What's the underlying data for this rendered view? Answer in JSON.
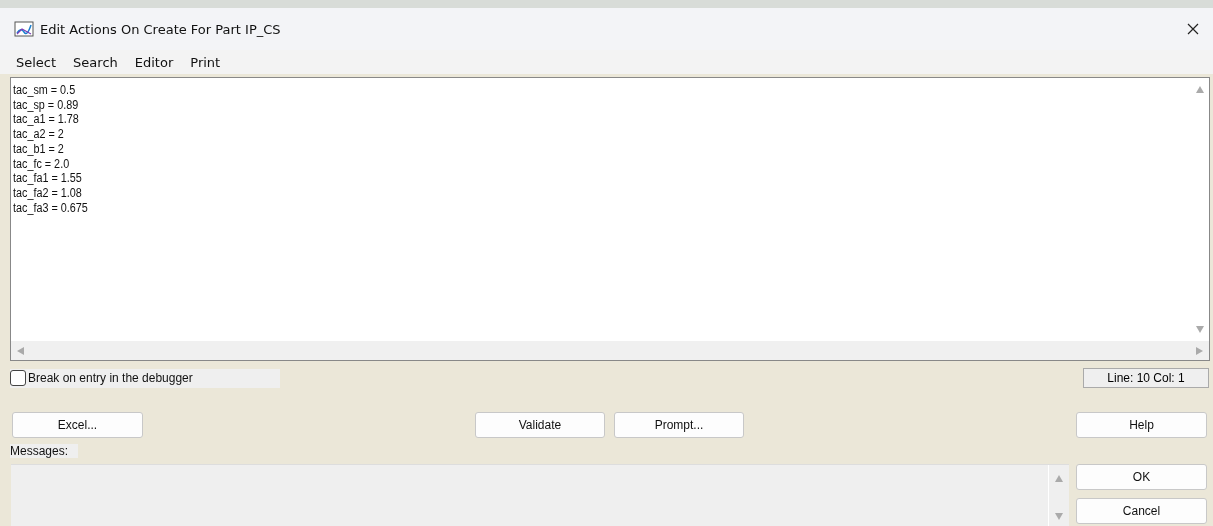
{
  "window": {
    "title": "Edit Actions On Create For Part IP_CS"
  },
  "menu": [
    "Select",
    "Search",
    "Editor",
    "Print"
  ],
  "editor": {
    "lines": [
      "tac_sm = 0.5",
      "tac_sp = 0.89",
      "tac_a1 = 1.78",
      "tac_a2 = 2",
      "tac_b1 = 2",
      "tac_fc = 2.0",
      "tac_fa1 = 1.55",
      "tac_fa2 = 1.08",
      "tac_fa3 = 0.675"
    ]
  },
  "debugger_checkbox": {
    "label": "Break on entry in the debugger",
    "checked": false
  },
  "cursor_position": "Line: 10 Col: 1",
  "buttons": {
    "excel": "Excel...",
    "validate": "Validate",
    "prompt": "Prompt...",
    "help": "Help"
  },
  "messages": {
    "label": "Messages:"
  },
  "dialog_buttons": [
    "OK",
    "Cancel"
  ]
}
